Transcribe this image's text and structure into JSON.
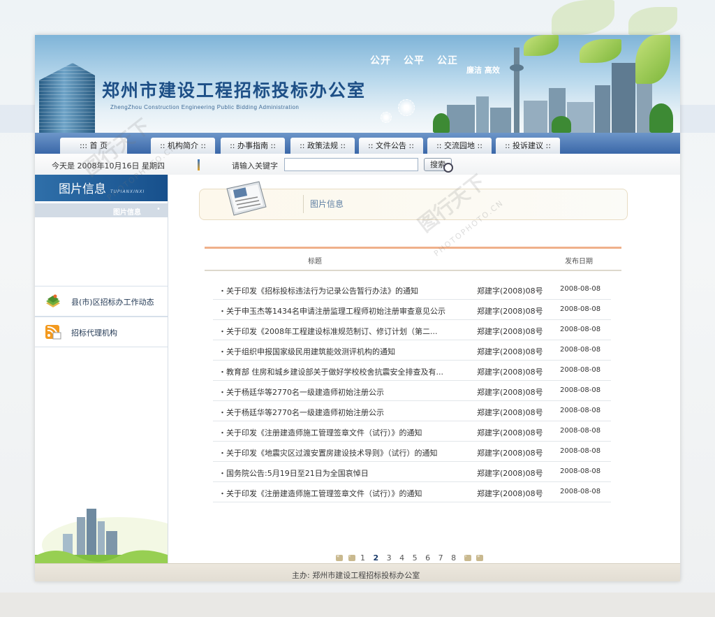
{
  "banner": {
    "title": "郑州市建设工程招标投标办公室",
    "subtitle": "ZhengZhou Construction Engineering Public Bidding Administration",
    "slogans": [
      "公开",
      "公平",
      "公正"
    ],
    "slogan_small": "廉洁 高效"
  },
  "nav": {
    "items": [
      {
        "label": ":::  首  页"
      },
      {
        "label": ":: 机构简介 ::"
      },
      {
        "label": ":: 办事指南 ::"
      },
      {
        "label": ":: 政策法规 ::"
      },
      {
        "label": ":: 文件公告 ::"
      },
      {
        "label": ":: 交流园地 ::"
      },
      {
        "label": ":: 投诉建议 ::"
      }
    ]
  },
  "toolbar": {
    "date_text": "今天是 2008年10月16日 星期四",
    "keyword_label": "请输入关键字",
    "search_value": "",
    "search_button": "搜索"
  },
  "sidebar": {
    "title": "图片信息",
    "title_en": "TUPIANXINXI",
    "sub_label": "图片信息",
    "sub_dot": "•",
    "links": [
      {
        "label": "县(市)区招标办工作动态",
        "icon": "books-icon"
      },
      {
        "label": "招标代理机构",
        "icon": "rss-feed-icon"
      }
    ]
  },
  "main": {
    "section_title": "图片信息",
    "col_title": "标题",
    "col_date": "发布日期",
    "rows": [
      {
        "title": "・关于印发《招标投标违法行为记录公告暂行办法》的通知",
        "num": "郑建字(2008)08号",
        "date": "2008-08-08"
      },
      {
        "title": "・关于申玉杰等1434名申请注册监理工程师初始注册审查意见公示",
        "num": "郑建字(2008)08号",
        "date": "2008-08-08"
      },
      {
        "title": "・关于印发《2008年工程建设标准规范制订、修订计划（第二...",
        "num": "郑建字(2008)08号",
        "date": "2008-08-08"
      },
      {
        "title": "・关于组织申报国家级民用建筑能效测评机构的通知",
        "num": "郑建字(2008)08号",
        "date": "2008-08-08"
      },
      {
        "title": "・教育部 住房和城乡建设部关于做好学校校舍抗震安全排查及有...",
        "num": "郑建字(2008)08号",
        "date": "2008-08-08"
      },
      {
        "title": "・关于杨廷华等2770名一级建造师初始注册公示",
        "num": "郑建字(2008)08号",
        "date": "2008-08-08"
      },
      {
        "title": "・关于杨廷华等2770名一级建造师初始注册公示",
        "num": "郑建字(2008)08号",
        "date": "2008-08-08"
      },
      {
        "title": "・关于印发《注册建造师施工管理签章文件（试行）》的通知",
        "num": "郑建字(2008)08号",
        "date": "2008-08-08"
      },
      {
        "title": "・关于印发《地震灾区过渡安置房建设技术导则》（试行）的通知",
        "num": "郑建字(2008)08号",
        "date": "2008-08-08"
      },
      {
        "title": "・国务院公告:5月19日至21日为全国哀悼日",
        "num": "郑建字(2008)08号",
        "date": "2008-08-08"
      },
      {
        "title": "・关于印发《注册建造师施工管理签章文件（试行）》的通知",
        "num": "郑建字(2008)08号",
        "date": "2008-08-08"
      }
    ],
    "pages": [
      "1",
      "2",
      "3",
      "4",
      "5",
      "6",
      "7",
      "8"
    ],
    "current_page": "2"
  },
  "footer": {
    "host": "主办: 郑州市建设工程招标投标办公室"
  },
  "watermark": {
    "cn": "图行天下",
    "en": "PHOTOPHOTO.CN"
  },
  "colors": {
    "nav_blue": "#3a67a8",
    "title_blue": "#1d4f86",
    "accent_orange": "#efb08a"
  }
}
